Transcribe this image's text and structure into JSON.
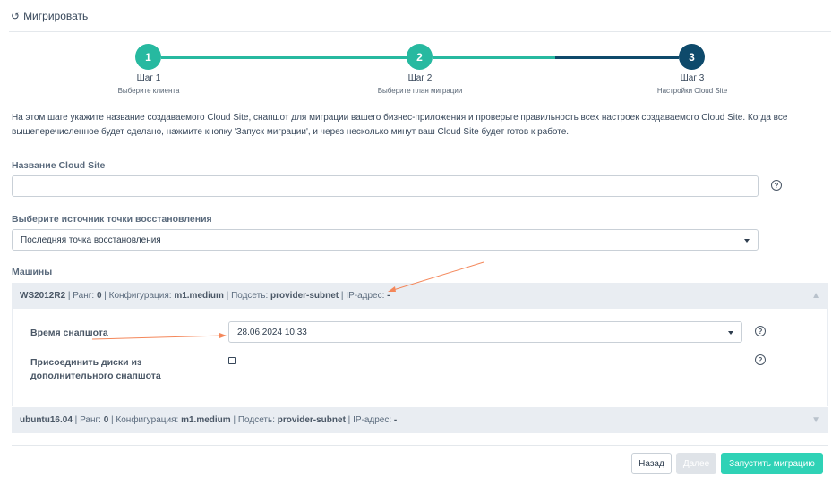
{
  "header": {
    "title": "Мигрировать",
    "icon": "undo-icon"
  },
  "stepper": {
    "colors": {
      "done": "#27b9a0",
      "active": "#0e4a6b"
    },
    "steps": [
      {
        "number": "1",
        "title": "Шаг 1",
        "subtitle": "Выберите клиента"
      },
      {
        "number": "2",
        "title": "Шаг 2",
        "subtitle": "Выберите план миграции"
      },
      {
        "number": "3",
        "title": "Шаг 3",
        "subtitle": "Настройки Cloud Site"
      }
    ]
  },
  "intro": "На этом шаге укажите название создаваемого Cloud Site, снапшот для миграции вашего бизнес-приложения и проверьте правильность всех настроек создаваемого Cloud Site. Когда все вышеперечисленное будет сделано, нажмите кнопку 'Запуск миграции', и через несколько минут ваш Cloud Site будет готов к работе.",
  "form": {
    "cloud_site_label": "Название Cloud Site",
    "cloud_site_value": "",
    "restore_source_label": "Выберите источник точки восстановления",
    "restore_source_value": "Последняя точка восстановления",
    "machines_label": "Машины"
  },
  "machines": [
    {
      "name": "WS2012R2",
      "rank_label": "Ранг:",
      "rank": "0",
      "config_label": "Конфигурация:",
      "config": "m1.medium",
      "subnet_label": "Подсеть:",
      "subnet": "provider-subnet",
      "ip_label": "IP-адрес:",
      "ip": "-",
      "expanded": true,
      "snapshot_time_label": "Время снапшота",
      "snapshot_time_value": "28.06.2024 10:33",
      "attach_disks_label_1": "Присоединить диски из",
      "attach_disks_label_2": "дополнительного снапшота",
      "attach_disks_checked": false
    },
    {
      "name": "ubuntu16.04",
      "rank_label": "Ранг:",
      "rank": "0",
      "config_label": "Конфигурация:",
      "config": "m1.medium",
      "subnet_label": "Подсеть:",
      "subnet": "provider-subnet",
      "ip_label": "IP-адрес:",
      "ip": "-",
      "expanded": false
    }
  ],
  "buttons": {
    "back": "Назад",
    "next": "Далее",
    "launch": "Запустить миграцию"
  },
  "annotation_color": "#f4875a"
}
